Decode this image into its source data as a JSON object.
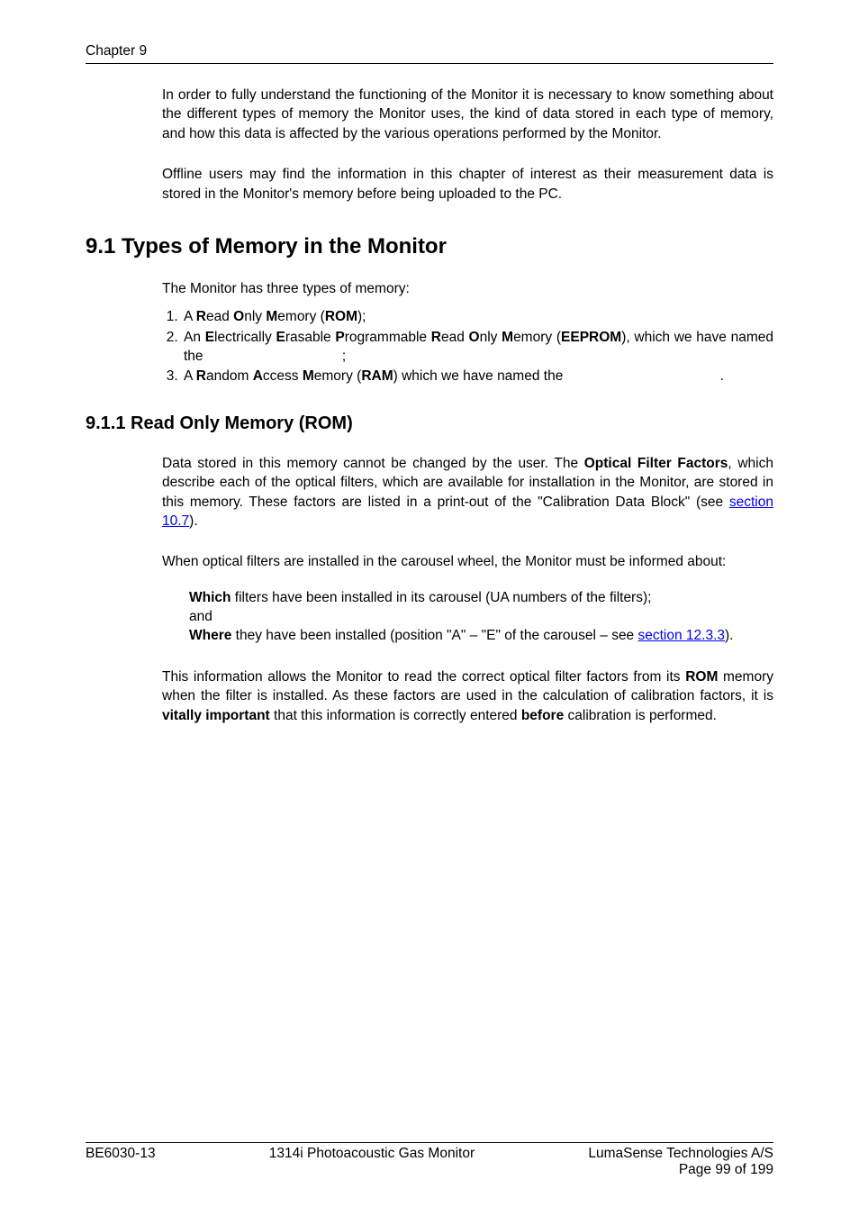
{
  "header": {
    "chapter": "Chapter 9"
  },
  "para1": "In order to fully understand the functioning of the Monitor it is necessary to know something about the different types of memory the Monitor uses, the kind of data stored in each type of memory, and how this data is affected by the various operations performed by the Monitor.",
  "para2": "Offline users may find the information in this chapter of interest as their measurement data is stored in the Monitor's memory before being uploaded to the PC.",
  "h2": "9.1 Types of Memory in the Monitor",
  "introList": "The Monitor has three types of memory:",
  "list": {
    "i1": {
      "a": "A ",
      "b1": "R",
      "c1": "ead ",
      "b2": "O",
      "c2": "nly ",
      "b3": "M",
      "c3": "emory (",
      "b4": "ROM",
      "c4": ");"
    },
    "i2": {
      "a": "An ",
      "b1": "E",
      "c1": "lectrically ",
      "b2": "E",
      "c2": "rasable ",
      "b3": "P",
      "c3": "rogrammable ",
      "b4": "R",
      "c4": "ead ",
      "b5": "O",
      "c5": "nly ",
      "b6": "M",
      "c6": "emory (",
      "b7": "EEPROM",
      "c7": "), which we have named the ",
      "tail": ";"
    },
    "i3": {
      "a": "A ",
      "b1": "R",
      "c1": "andom ",
      "b2": "A",
      "c2": "ccess ",
      "b3": "M",
      "c3": "emory (",
      "b4": "RAM",
      "c4": ") which we have named the ",
      "dot": "."
    }
  },
  "h3": "9.1.1    Read Only Memory (ROM)",
  "p911a": {
    "pre": "Data stored in this memory cannot be changed by the user. The ",
    "bold": "Optical Filter Factors",
    "post1": ", which describe each of the optical filters, which are available for installation in the Monitor, are stored in this memory. These factors are listed in a print-out of the \"Calibration Data Block\" (see ",
    "link": "section 10.7",
    "post2": ")."
  },
  "p911b": "When optical filters are installed in the carousel wheel, the Monitor must be informed about:",
  "which": {
    "b": "Which",
    "t": " filters have been installed in its carousel (UA numbers of the filters);"
  },
  "and": "and",
  "where": {
    "b": "Where",
    "t1": " they have been installed (position \"A\" – \"E\" of the carousel – see ",
    "link": "section 12.3.3",
    "t2": ")."
  },
  "p911c": {
    "pre": "This information allows the Monitor to read the correct optical filter factors from its ",
    "b1": "ROM",
    "mid": " memory when the filter is installed. As these factors are used in the calculation of calibration factors, it is ",
    "b2": "vitally important",
    "mid2": " that this information is correctly entered ",
    "b3": "before",
    "post": " calibration is performed."
  },
  "footer": {
    "left": "BE6030-13",
    "center": "1314i Photoacoustic Gas Monitor",
    "right1": "LumaSense Technologies A/S",
    "right2": "Page 99 of 199"
  }
}
